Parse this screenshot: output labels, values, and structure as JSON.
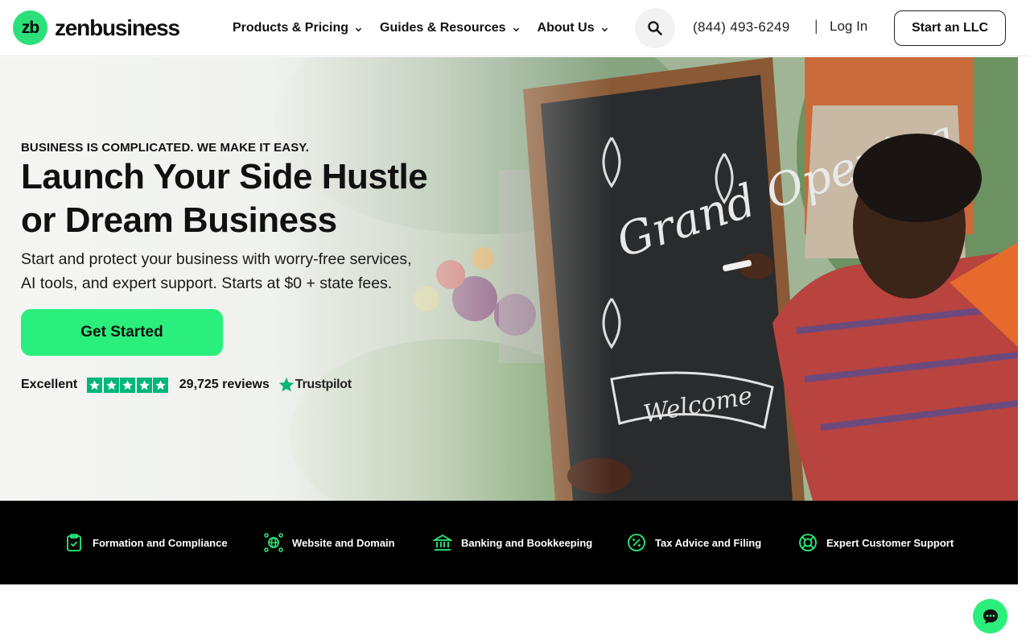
{
  "brand": {
    "badge": "zb",
    "name": "zenbusiness"
  },
  "nav": {
    "items": [
      {
        "label": "Products & Pricing"
      },
      {
        "label": "Guides & Resources"
      },
      {
        "label": "About Us"
      }
    ],
    "phone": "(844) 493-6249",
    "separator": "|",
    "login_label": "Log In",
    "cta_label": "Start an LLC"
  },
  "hero": {
    "eyebrow": "BUSINESS IS COMPLICATED. WE MAKE IT EASY.",
    "headline_line1": "Launch Your Side Hustle",
    "headline_line2": "or Dream Business",
    "subcopy_line1": "Start and protect your business with worry-free services,",
    "subcopy_line2": "AI tools, and expert support. Starts at $0 + state fees.",
    "cta_label": "Get Started",
    "chalkboard_text": "Grand Opening",
    "chalkboard_banner": "Welcome",
    "rating": {
      "word": "Excellent",
      "stars": 5,
      "reviews": "29,725 reviews",
      "provider": "Trustpilot"
    }
  },
  "features": [
    {
      "label": "Formation and Compliance",
      "icon": "clipboard-check-icon"
    },
    {
      "label": "Website and Domain",
      "icon": "globe-network-icon"
    },
    {
      "label": "Banking and Bookkeeping",
      "icon": "bank-icon"
    },
    {
      "label": "Tax Advice and Filing",
      "icon": "percent-icon"
    },
    {
      "label": "Expert Customer Support",
      "icon": "lifebuoy-icon"
    }
  ],
  "colors": {
    "accent": "#2bef7c",
    "trustpilot": "#00b67a",
    "feature_bar": "#000000"
  }
}
